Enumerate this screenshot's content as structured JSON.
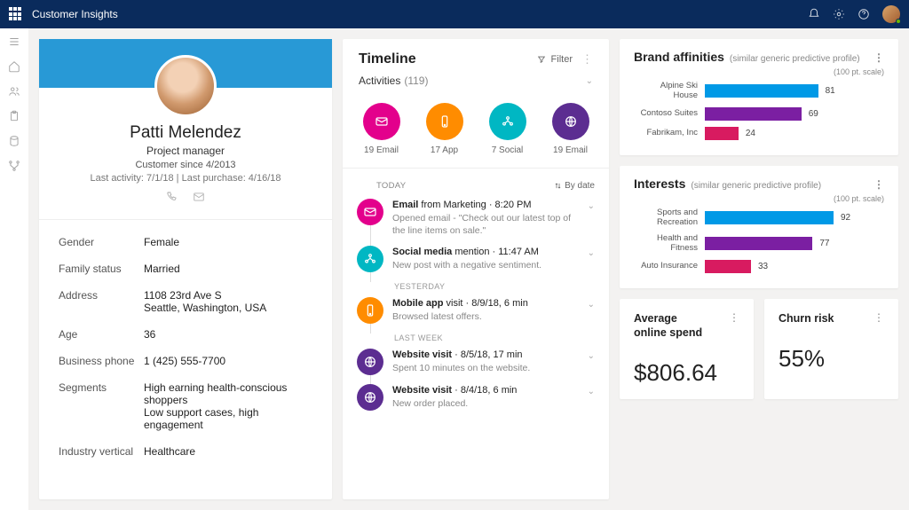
{
  "app_title": "Customer Insights",
  "profile": {
    "name": "Patti Melendez",
    "role": "Project manager",
    "since": "Customer since 4/2013",
    "activity_line": "Last activity: 7/1/18  |  Last purchase: 4/16/18",
    "details": [
      {
        "label": "Gender",
        "value": "Female"
      },
      {
        "label": "Family status",
        "value": "Married"
      },
      {
        "label": "Address",
        "value": "1108 23rd Ave S\nSeattle, Washington, USA"
      },
      {
        "label": "Age",
        "value": "36"
      },
      {
        "label": "Business phone",
        "value": "1 (425) 555-7700"
      },
      {
        "label": "Segments",
        "value": "High earning health-conscious shoppers\nLow support cases, high engagement"
      },
      {
        "label": "Industry vertical",
        "value": "Healthcare"
      }
    ]
  },
  "timeline": {
    "title": "Timeline",
    "filter_label": "Filter",
    "activities_label": "Activities",
    "activities_count": "(119)",
    "sort_label": "By date",
    "categories": [
      {
        "label": "19 Email",
        "color": "c-pink",
        "icon": "mail"
      },
      {
        "label": "17 App",
        "color": "c-orange",
        "icon": "phone"
      },
      {
        "label": "7 Social",
        "color": "c-cyan",
        "icon": "social"
      },
      {
        "label": "19 Email",
        "color": "c-purple",
        "icon": "globe"
      }
    ],
    "sections": [
      {
        "label": "TODAY",
        "items": [
          {
            "color": "c-pink",
            "icon": "mail",
            "title_strong": "Email",
            "title_rest": " from Marketing · 8:20 PM",
            "sub": "Opened  email - \"Check out our latest top of the line items on sale.\""
          },
          {
            "color": "c-cyan",
            "icon": "social",
            "title_strong": "Social media",
            "title_rest": " mention · 11:47 AM",
            "sub": "New post with a negative sentiment."
          }
        ]
      },
      {
        "label": "YESTERDAY",
        "items": [
          {
            "color": "c-orange",
            "icon": "phone",
            "title_strong": "Mobile app",
            "title_rest": " visit · 8/9/18, 6 min",
            "sub": "Browsed latest offers."
          }
        ]
      },
      {
        "label": "LAST WEEK",
        "items": [
          {
            "color": "c-purple",
            "icon": "globe",
            "title_strong": "Website visit",
            "title_rest": " · 8/5/18, 17 min",
            "sub": "Spent 10 minutes on the website."
          },
          {
            "color": "c-purple",
            "icon": "globe",
            "title_strong": "Website visit",
            "title_rest": " · 8/4/18, 6 min",
            "sub": "New order placed."
          }
        ]
      }
    ]
  },
  "brand": {
    "title": "Brand affinities",
    "subtitle": "(similar generic predictive profile)",
    "scale": "(100 pt. scale)"
  },
  "interests": {
    "title": "Interests",
    "subtitle": "(similar generic predictive profile)",
    "scale": "(100 pt. scale)"
  },
  "kpi": {
    "avg_title": "Average online spend",
    "avg_value": "$806.64",
    "churn_title": "Churn risk",
    "churn_value": "55%"
  },
  "chart_data": [
    {
      "type": "bar",
      "title": "Brand affinities",
      "xlabel": "",
      "ylabel": "",
      "ylim": [
        0,
        100
      ],
      "categories": [
        "Alpine Ski House",
        "Contoso Suites",
        "Fabrikam, Inc"
      ],
      "values": [
        81,
        69,
        24
      ],
      "colors": [
        "#0099e6",
        "#7b1fa2",
        "#d81b60"
      ]
    },
    {
      "type": "bar",
      "title": "Interests",
      "xlabel": "",
      "ylabel": "",
      "ylim": [
        0,
        100
      ],
      "categories": [
        "Sports and Recreation",
        "Health and Fitness",
        "Auto Insurance"
      ],
      "values": [
        92,
        77,
        33
      ],
      "colors": [
        "#0099e6",
        "#7b1fa2",
        "#d81b60"
      ]
    }
  ]
}
